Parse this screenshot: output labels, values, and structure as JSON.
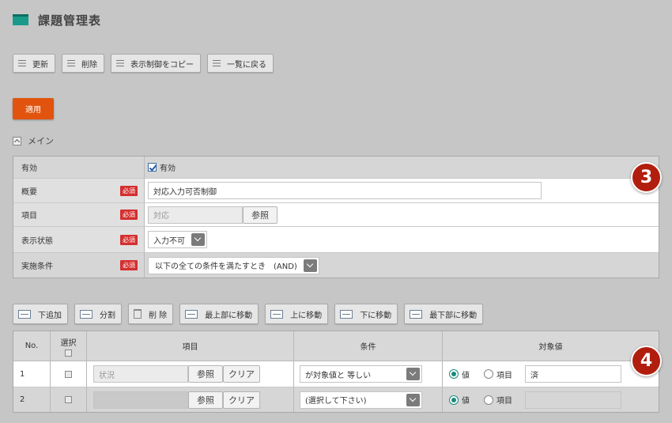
{
  "header": {
    "title": "課題管理表",
    "icon": "window-icon",
    "accent": "#1a9a8a"
  },
  "toolbar": {
    "buttons": [
      {
        "label": "更新",
        "icon": "list-icon"
      },
      {
        "label": "削除",
        "icon": "list-icon"
      },
      {
        "label": "表示制御をコピー",
        "icon": "list-icon"
      },
      {
        "label": "一覧に戻る",
        "icon": "list-icon"
      }
    ]
  },
  "apply_button": {
    "label": "適用",
    "color": "#e2540e"
  },
  "section": {
    "label": "メイン"
  },
  "form": {
    "required_label": "必須",
    "rows": {
      "enabled": {
        "label": "有効",
        "checkbox_label": "有効",
        "checked": true
      },
      "summary": {
        "label": "概要",
        "value": "対応入力可否制御"
      },
      "item": {
        "label": "項目",
        "value": "対応",
        "button": "参照"
      },
      "display_state": {
        "label": "表示状態",
        "value": "入力不可"
      },
      "condition": {
        "label": "実施条件",
        "value": "以下の全ての条件を満たすとき　(AND)"
      }
    }
  },
  "badges": [
    "3",
    "4"
  ],
  "grid_toolbar": {
    "buttons": [
      {
        "label": "下追加",
        "icon": "add-row-icon"
      },
      {
        "label": "分割",
        "icon": "split-icon"
      },
      {
        "label": "削 除",
        "icon": "trash-icon"
      },
      {
        "label": "最上部に移動",
        "icon": "move-top-icon"
      },
      {
        "label": "上に移動",
        "icon": "move-up-icon"
      },
      {
        "label": "下に移動",
        "icon": "move-down-icon"
      },
      {
        "label": "最下部に移動",
        "icon": "move-bottom-icon"
      }
    ]
  },
  "grid": {
    "headers": {
      "no": "No.",
      "select": "選択",
      "item": "項目",
      "condition": "条件",
      "value": "対象値"
    },
    "ref_button": "参照",
    "clear_button": "クリア",
    "radio_value": "値",
    "radio_item": "項目",
    "rows": [
      {
        "no": "1",
        "item": "状況",
        "condition": "が対象値と 等しい",
        "value": "済"
      },
      {
        "no": "2",
        "item": "",
        "condition": "(選択して下さい)",
        "value": ""
      }
    ]
  }
}
